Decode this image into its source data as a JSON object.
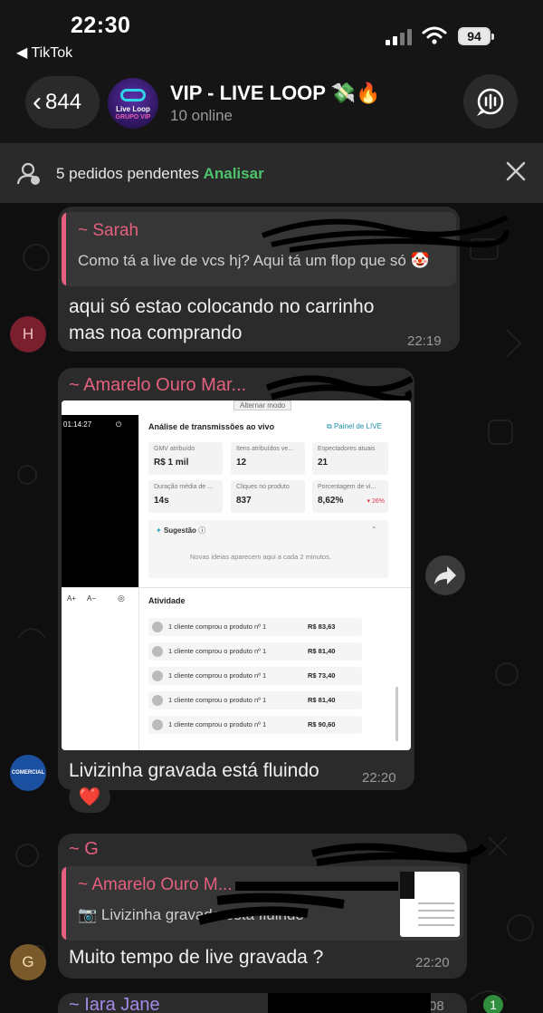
{
  "status_bar": {
    "time": "22:30",
    "back_app": "TikTok",
    "battery": "94"
  },
  "header": {
    "back_count": "844",
    "group_name": "VIP - LIVE LOOP 💸🔥",
    "online": "10 online",
    "avatar_line1": "Live Loop",
    "avatar_line2": "GRUPO VIP"
  },
  "pending": {
    "text": "5 pedidos pendentes",
    "action": "Analisar"
  },
  "messages": [
    {
      "quote_author": "~ Sarah",
      "quote_text": "Como tá a live de vcs hj? Aqui tá um flop que só 🤡",
      "text": "aqui só estao colocando no carrinho mas noa comprando",
      "time": "22:19",
      "avatar_letter": "H"
    },
    {
      "sender": "~ Amarelo Ouro Mar...",
      "text": "Livizinha gravada está fluindo",
      "time": "22:20",
      "reaction": "❤️",
      "avatar_text": "COMERCIAL"
    },
    {
      "sender": "~ G",
      "quote_author": "~ Amarelo Ouro M...",
      "quote_text": "Livizinha gravada está fluindo",
      "text": "Muito tempo de live gravada ?",
      "time": "22:20",
      "avatar_letter": "G"
    },
    {
      "sender": "~ Iara Jane",
      "time_partial": "08"
    }
  ],
  "screenshot": {
    "timer": "01:14:27",
    "section_title": "Análise de transmissões ao vivo",
    "panel_link": "Painel de LIVE",
    "top_tab": "Alternar modo",
    "metrics": [
      {
        "label": "GMV atribuído",
        "value": "R$ 1 mil",
        "delta": ""
      },
      {
        "label": "Itens atribuídos ve...",
        "value": "12",
        "delta": ""
      },
      {
        "label": "Espectadores atuais",
        "value": "21",
        "delta": ""
      },
      {
        "label": "Duração média de ...",
        "value": "14s",
        "delta": ""
      },
      {
        "label": "Cliques no produto",
        "value": "837",
        "delta": ""
      },
      {
        "label": "Porcentagem de vi...",
        "value": "8,62%",
        "delta": "▾ 26%"
      }
    ],
    "suggestion_title": "Sugestão",
    "suggestion_text": "Novas ideias aparecem aqui a cada 2 minutos.",
    "activity_title": "Atividade",
    "font_controls": [
      "A+",
      "A−"
    ],
    "activity": [
      {
        "text": "1 cliente comprou o produto nº 1",
        "price": "R$ 83,63"
      },
      {
        "text": "1 cliente comprou o produto nº 1",
        "price": "R$ 81,40"
      },
      {
        "text": "1 cliente comprou o produto nº 1",
        "price": "R$ 73,40"
      },
      {
        "text": "1 cliente comprou o produto nº 1",
        "price": "R$ 81,40"
      },
      {
        "text": "1 cliente comprou o produto nº 1",
        "price": "R$ 90,60"
      }
    ]
  },
  "unread_badge": "1",
  "colors": {
    "accent_pink": "#e4607e",
    "accent_green": "#4cc36a",
    "bubble": "#2b2b2b",
    "background": "#0f0f0f"
  }
}
